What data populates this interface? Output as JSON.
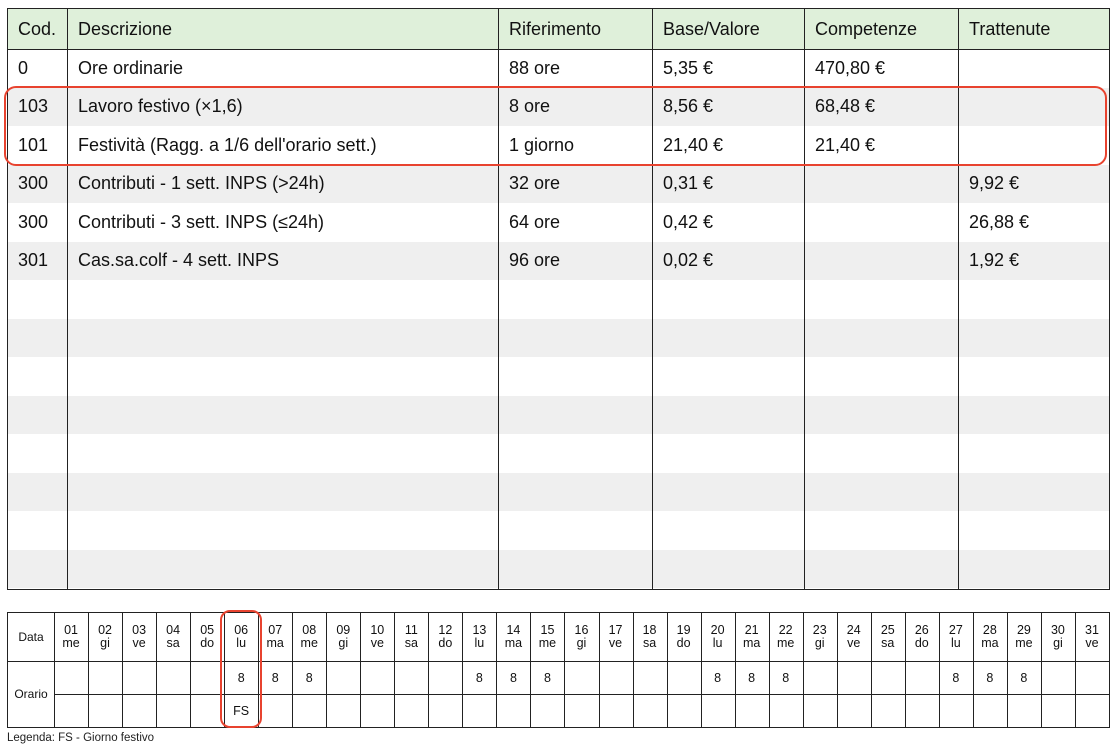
{
  "table": {
    "headers": [
      "Cod.",
      "Descrizione",
      "Riferimento",
      "Base/Valore",
      "Competenze",
      "Trattenute"
    ],
    "rows": [
      {
        "cod": "0",
        "desc": "Ore ordinarie",
        "rif": "88 ore",
        "base": "5,35 €",
        "comp": "470,80 €",
        "tratt": ""
      },
      {
        "cod": "103",
        "desc": "Lavoro festivo (×1,6)",
        "rif": "8 ore",
        "base": "8,56 €",
        "comp": "68,48 €",
        "tratt": ""
      },
      {
        "cod": "101",
        "desc": "Festività (Ragg. a 1/6 dell'orario sett.)",
        "rif": "1 giorno",
        "base": "21,40 €",
        "comp": "21,40 €",
        "tratt": ""
      },
      {
        "cod": "300",
        "desc": "Contributi - 1 sett. INPS (>24h)",
        "rif": "32 ore",
        "base": "0,31 €",
        "comp": "",
        "tratt": "9,92 €"
      },
      {
        "cod": "300",
        "desc": "Contributi - 3 sett. INPS (≤24h)",
        "rif": "64 ore",
        "base": "0,42 €",
        "comp": "",
        "tratt": "26,88 €"
      },
      {
        "cod": "301",
        "desc": "Cas.sa.colf - 4 sett. INPS",
        "rif": "96 ore",
        "base": "0,02 €",
        "comp": "",
        "tratt": "1,92 €"
      }
    ],
    "highlight_color": "#e8432f",
    "header_color": "#dff0da"
  },
  "calendar": {
    "label_data": "Data",
    "label_orario": "Orario",
    "days": [
      {
        "n": "01",
        "d": "me",
        "h": "",
        "c": ""
      },
      {
        "n": "02",
        "d": "gi",
        "h": "",
        "c": ""
      },
      {
        "n": "03",
        "d": "ve",
        "h": "",
        "c": ""
      },
      {
        "n": "04",
        "d": "sa",
        "h": "",
        "c": ""
      },
      {
        "n": "05",
        "d": "do",
        "h": "",
        "c": ""
      },
      {
        "n": "06",
        "d": "lu",
        "h": "8",
        "c": "FS"
      },
      {
        "n": "07",
        "d": "ma",
        "h": "8",
        "c": ""
      },
      {
        "n": "08",
        "d": "me",
        "h": "8",
        "c": ""
      },
      {
        "n": "09",
        "d": "gi",
        "h": "",
        "c": ""
      },
      {
        "n": "10",
        "d": "ve",
        "h": "",
        "c": ""
      },
      {
        "n": "11",
        "d": "sa",
        "h": "",
        "c": ""
      },
      {
        "n": "12",
        "d": "do",
        "h": "",
        "c": ""
      },
      {
        "n": "13",
        "d": "lu",
        "h": "8",
        "c": ""
      },
      {
        "n": "14",
        "d": "ma",
        "h": "8",
        "c": ""
      },
      {
        "n": "15",
        "d": "me",
        "h": "8",
        "c": ""
      },
      {
        "n": "16",
        "d": "gi",
        "h": "",
        "c": ""
      },
      {
        "n": "17",
        "d": "ve",
        "h": "",
        "c": ""
      },
      {
        "n": "18",
        "d": "sa",
        "h": "",
        "c": ""
      },
      {
        "n": "19",
        "d": "do",
        "h": "",
        "c": ""
      },
      {
        "n": "20",
        "d": "lu",
        "h": "8",
        "c": ""
      },
      {
        "n": "21",
        "d": "ma",
        "h": "8",
        "c": ""
      },
      {
        "n": "22",
        "d": "me",
        "h": "8",
        "c": ""
      },
      {
        "n": "23",
        "d": "gi",
        "h": "",
        "c": ""
      },
      {
        "n": "24",
        "d": "ve",
        "h": "",
        "c": ""
      },
      {
        "n": "25",
        "d": "sa",
        "h": "",
        "c": ""
      },
      {
        "n": "26",
        "d": "do",
        "h": "",
        "c": ""
      },
      {
        "n": "27",
        "d": "lu",
        "h": "8",
        "c": ""
      },
      {
        "n": "28",
        "d": "ma",
        "h": "8",
        "c": ""
      },
      {
        "n": "29",
        "d": "me",
        "h": "8",
        "c": ""
      },
      {
        "n": "30",
        "d": "gi",
        "h": "",
        "c": ""
      },
      {
        "n": "31",
        "d": "ve",
        "h": "",
        "c": ""
      }
    ]
  },
  "legend": "Legenda: FS - Giorno festivo"
}
